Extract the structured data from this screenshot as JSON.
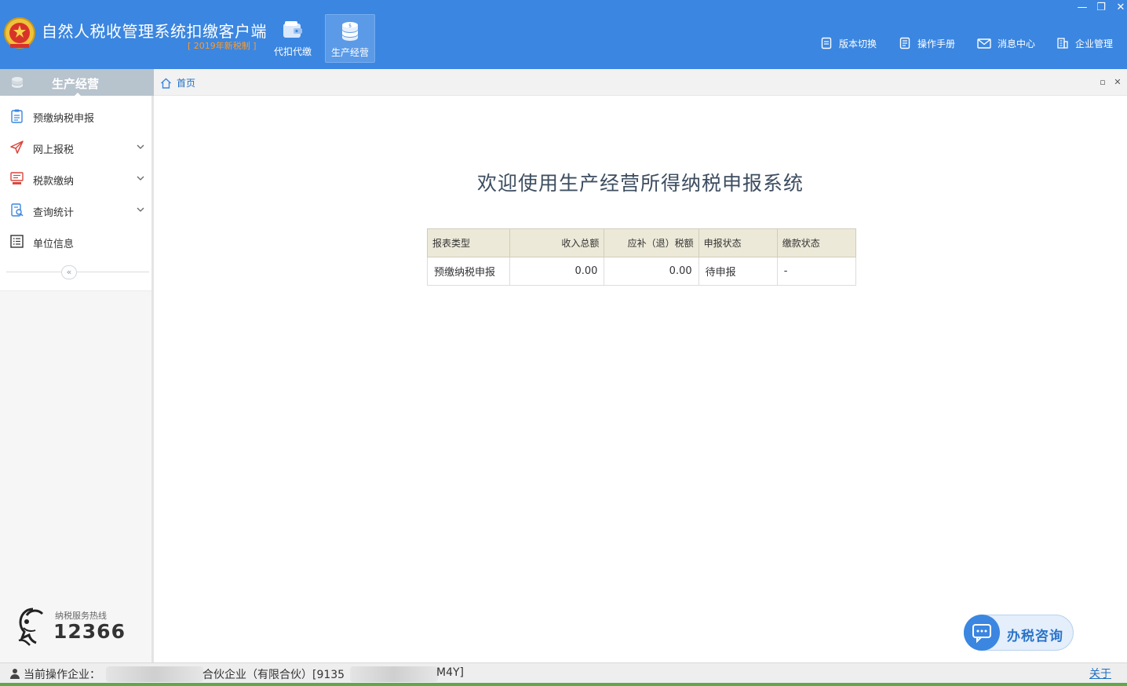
{
  "colors": {
    "header_bg": "#3b86e0",
    "accent_orange": "#ff9a28",
    "link_blue": "#1f6fc1",
    "table_head_bg": "#ece9d8"
  },
  "header": {
    "title": "自然人税收管理系统扣缴客户端",
    "subtitle": "[ 2019年新税制 ]",
    "modules": [
      {
        "label": "代扣代缴",
        "icon": "wallet-icon",
        "active": false
      },
      {
        "label": "生产经营",
        "icon": "coin-stack-icon",
        "active": true
      }
    ],
    "links": [
      {
        "label": "版本切换",
        "icon": "document-icon"
      },
      {
        "label": "操作手册",
        "icon": "manual-icon"
      },
      {
        "label": "消息中心",
        "icon": "mail-icon"
      },
      {
        "label": "企业管理",
        "icon": "building-icon"
      }
    ],
    "window_controls": {
      "minimize": "—",
      "restore": "❐",
      "close": "✕"
    }
  },
  "sidebar": {
    "title": "生产经营",
    "items": [
      {
        "label": "预缴纳税申报",
        "icon": "clipboard-icon",
        "expandable": false
      },
      {
        "label": "网上报税",
        "icon": "send-icon",
        "expandable": true
      },
      {
        "label": "税款缴纳",
        "icon": "payment-terminal-icon",
        "expandable": true
      },
      {
        "label": "查询统计",
        "icon": "search-document-icon",
        "expandable": true
      },
      {
        "label": "单位信息",
        "icon": "list-icon",
        "expandable": false
      }
    ],
    "collapse_symbol": "«",
    "hotline": {
      "label": "纳税服务热线",
      "number": "12366"
    }
  },
  "tabs": {
    "home": "首页",
    "restore": "▫",
    "close": "✕"
  },
  "main": {
    "welcome": "欢迎使用生产经营所得纳税申报系统",
    "table": {
      "columns": [
        "报表类型",
        "收入总额",
        "应补（退）税额",
        "申报状态",
        "缴款状态"
      ],
      "rows": [
        [
          "预缴纳税申报",
          "0.00",
          "0.00",
          "待申报",
          "-"
        ]
      ]
    },
    "consult_button": "办税咨询"
  },
  "statusbar": {
    "prefix": "当前操作企业：",
    "company_mid": "合伙企业（有限合伙）[9135",
    "company_end": "M4Y]",
    "about": "关于"
  }
}
